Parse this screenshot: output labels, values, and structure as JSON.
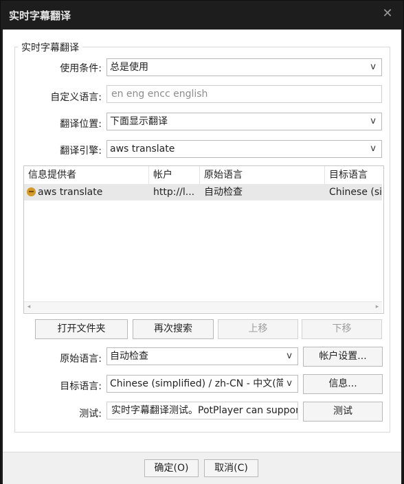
{
  "window": {
    "title": "实时字幕翻译",
    "close_symbol": "✕"
  },
  "group": {
    "title": "实时字幕翻译"
  },
  "form": {
    "condition": {
      "label": "使用条件:",
      "value": "总是使用"
    },
    "custom_language": {
      "label": "自定义语言:",
      "placeholder": "en eng encc english"
    },
    "position": {
      "label": "翻译位置:",
      "value": "下面显示翻译"
    },
    "engine": {
      "label": "翻译引擎:",
      "value": "aws translate"
    }
  },
  "list": {
    "columns": [
      "信息提供者",
      "帐户",
      "原始语言",
      "目标语言"
    ],
    "rows": [
      {
        "provider": "aws translate",
        "account": "http://l...",
        "source": "自动检查",
        "target": "Chinese (sin"
      }
    ],
    "scroll_left": "◂",
    "scroll_right": "▸"
  },
  "buttons": {
    "open_folder": "打开文件夹",
    "search_again": "再次搜索",
    "move_up": "上移",
    "move_down": "下移",
    "account_settings": "帐户设置...",
    "info": "信息...",
    "test": "测试"
  },
  "bottom_form": {
    "source_language": {
      "label": "原始语言:",
      "value": "自动检查"
    },
    "target_language": {
      "label": "目标语言:",
      "value": "Chinese (simplified) / zh-CN - 中文(简"
    },
    "test": {
      "label": "测试:",
      "value": "实时字幕翻译测试。PotPlayer can support"
    }
  },
  "footer": {
    "ok": "确定(O)",
    "cancel": "取消(C)"
  },
  "chevron": "v"
}
